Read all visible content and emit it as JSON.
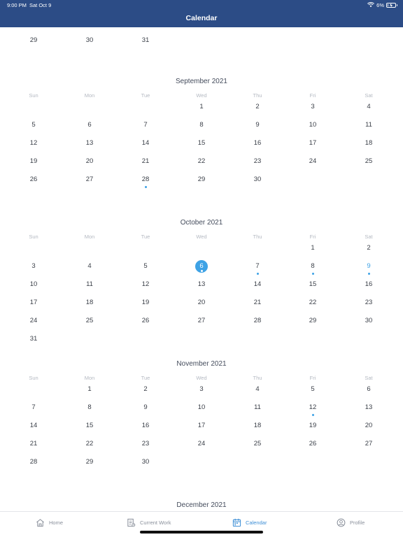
{
  "status_bar": {
    "time": "9:00 PM",
    "date": "Sat Oct 9",
    "battery": "6%",
    "battery_level": 0.06
  },
  "nav": {
    "title": "Calendar"
  },
  "weekdays": [
    "Sun",
    "Mon",
    "Tue",
    "Wed",
    "Thu",
    "Fri",
    "Sat"
  ],
  "months": [
    {
      "title": "",
      "show_weekdays": false,
      "weeks": [
        [
          {
            "d": "29"
          },
          {
            "d": "30"
          },
          {
            "d": "31"
          },
          null,
          null,
          null,
          null
        ]
      ]
    },
    {
      "title": "September 2021",
      "show_weekdays": true,
      "weeks": [
        [
          null,
          null,
          null,
          {
            "d": "1"
          },
          {
            "d": "2"
          },
          {
            "d": "3"
          },
          {
            "d": "4"
          }
        ],
        [
          {
            "d": "5"
          },
          {
            "d": "6"
          },
          {
            "d": "7"
          },
          {
            "d": "8"
          },
          {
            "d": "9"
          },
          {
            "d": "10"
          },
          {
            "d": "11"
          }
        ],
        [
          {
            "d": "12"
          },
          {
            "d": "13"
          },
          {
            "d": "14"
          },
          {
            "d": "15"
          },
          {
            "d": "16"
          },
          {
            "d": "17"
          },
          {
            "d": "18"
          }
        ],
        [
          {
            "d": "19"
          },
          {
            "d": "20"
          },
          {
            "d": "21"
          },
          {
            "d": "22"
          },
          {
            "d": "23"
          },
          {
            "d": "24"
          },
          {
            "d": "25"
          }
        ],
        [
          {
            "d": "26"
          },
          {
            "d": "27"
          },
          {
            "d": "28",
            "dot": true
          },
          {
            "d": "29"
          },
          {
            "d": "30"
          },
          null,
          null
        ]
      ]
    },
    {
      "title": "October 2021",
      "show_weekdays": true,
      "weeks": [
        [
          null,
          null,
          null,
          null,
          null,
          {
            "d": "1"
          },
          {
            "d": "2"
          }
        ],
        [
          {
            "d": "3"
          },
          {
            "d": "4"
          },
          {
            "d": "5"
          },
          {
            "d": "6",
            "today": true,
            "dot": true
          },
          {
            "d": "7",
            "dot": true
          },
          {
            "d": "8",
            "dot": true
          },
          {
            "d": "9",
            "dot": true,
            "highlight": true
          }
        ],
        [
          {
            "d": "10"
          },
          {
            "d": "11"
          },
          {
            "d": "12"
          },
          {
            "d": "13"
          },
          {
            "d": "14"
          },
          {
            "d": "15"
          },
          {
            "d": "16"
          }
        ],
        [
          {
            "d": "17"
          },
          {
            "d": "18"
          },
          {
            "d": "19"
          },
          {
            "d": "20"
          },
          {
            "d": "21"
          },
          {
            "d": "22"
          },
          {
            "d": "23"
          }
        ],
        [
          {
            "d": "24"
          },
          {
            "d": "25"
          },
          {
            "d": "26"
          },
          {
            "d": "27"
          },
          {
            "d": "28"
          },
          {
            "d": "29"
          },
          {
            "d": "30"
          }
        ],
        [
          {
            "d": "31"
          },
          null,
          null,
          null,
          null,
          null,
          null
        ]
      ]
    },
    {
      "title": "November 2021",
      "show_weekdays": true,
      "weeks": [
        [
          null,
          {
            "d": "1"
          },
          {
            "d": "2"
          },
          {
            "d": "3"
          },
          {
            "d": "4"
          },
          {
            "d": "5"
          },
          {
            "d": "6"
          }
        ],
        [
          {
            "d": "7"
          },
          {
            "d": "8"
          },
          {
            "d": "9"
          },
          {
            "d": "10"
          },
          {
            "d": "11"
          },
          {
            "d": "12",
            "dot": true
          },
          {
            "d": "13"
          }
        ],
        [
          {
            "d": "14"
          },
          {
            "d": "15"
          },
          {
            "d": "16"
          },
          {
            "d": "17"
          },
          {
            "d": "18"
          },
          {
            "d": "19"
          },
          {
            "d": "20"
          }
        ],
        [
          {
            "d": "21"
          },
          {
            "d": "22"
          },
          {
            "d": "23"
          },
          {
            "d": "24"
          },
          {
            "d": "25"
          },
          {
            "d": "26"
          },
          {
            "d": "27"
          }
        ],
        [
          {
            "d": "28"
          },
          {
            "d": "29"
          },
          {
            "d": "30"
          },
          null,
          null,
          null,
          null
        ]
      ]
    },
    {
      "title": "December 2021",
      "show_weekdays": false,
      "weeks": []
    }
  ],
  "tabs": [
    {
      "label": "Home",
      "icon": "home-icon",
      "active": false
    },
    {
      "label": "Current Work",
      "icon": "current-work-icon",
      "active": false
    },
    {
      "label": "Calendar",
      "icon": "calendar-icon",
      "active": true
    },
    {
      "label": "Profile",
      "icon": "profile-icon",
      "active": false
    }
  ],
  "colors": {
    "header": "#2c4c86",
    "accent": "#3ea2e5",
    "tab_active": "#3e8fd6"
  }
}
